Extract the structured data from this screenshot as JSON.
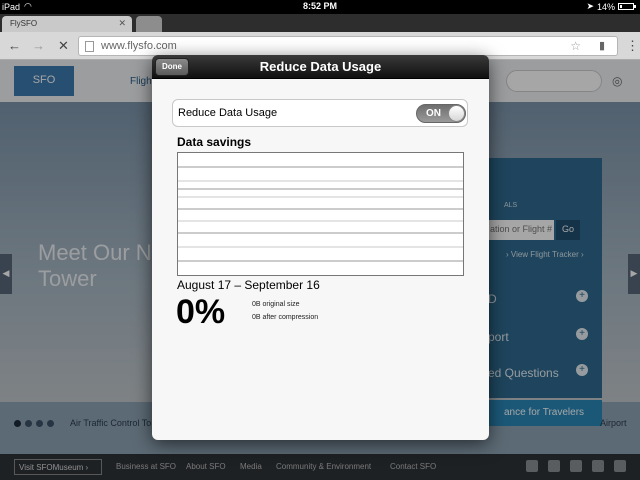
{
  "statusbar": {
    "device": "iPad",
    "time": "8:52 PM",
    "battery": "14%",
    "battery_level": 0.14
  },
  "browser": {
    "active_tab_title": "FlySFO",
    "url": "www.flysfo.com",
    "icons": [
      "wifi-icon",
      "location-arrow-icon",
      "back-icon",
      "forward-icon",
      "stop-icon",
      "page-icon",
      "star-icon",
      "mic-icon",
      "menu-icon",
      "close-icon"
    ]
  },
  "webpage": {
    "logo_text": "SFO",
    "nav_fragment": "Fligh",
    "hero_title": "Meet Our N Tower",
    "flight_input_placeholder": "ation or Flight #",
    "flight_go_label": "Go",
    "flight_tracker_link": "› View Flight Tracker ›",
    "flights_label": "ALS",
    "panel_item_a": "D",
    "panel_item_b": "port",
    "panel_item_c": "ed Questions",
    "travelers_label": "ance for Travelers",
    "atc_caption": "Air Traffic Control To",
    "airport_caption": "Airport",
    "footer": {
      "museum_button": "Visit SFOMuseum ›",
      "links": [
        "Business at SFO",
        "About SFO",
        "Media",
        "Community & Environment",
        "Contact SFO"
      ]
    },
    "colors": {
      "panel": "#2f6b8f",
      "travelers_bar": "#2a88b8",
      "footer": "#2e3338"
    }
  },
  "modal": {
    "title": "Reduce Data Usage",
    "done_label": "Done",
    "setting_label": "Reduce Data Usage",
    "toggle_state": "ON",
    "savings_heading": "Data savings",
    "date_range": "August 17 – September 16",
    "percent": "0%",
    "original_size": "0B original size",
    "after_compression": "0B after compression"
  }
}
